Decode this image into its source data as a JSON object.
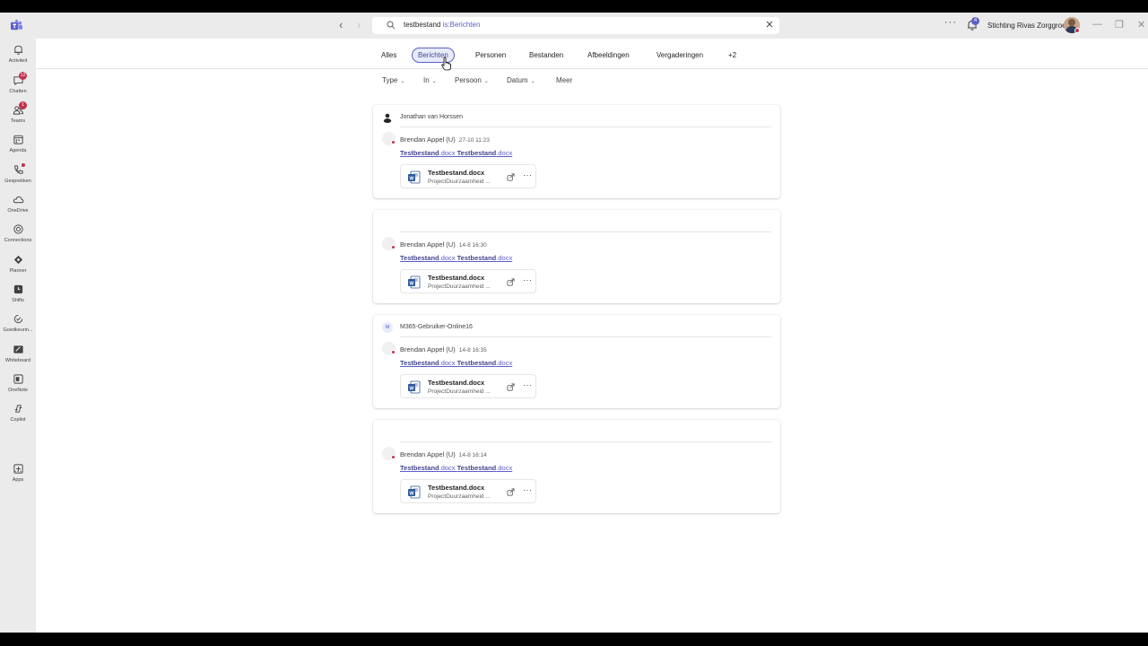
{
  "titlebar": {
    "search_query": "testbestand",
    "search_scope": "is:Berichten",
    "notification_count": "4",
    "org_name": "Stichting Rivas Zorggroep"
  },
  "rail": {
    "items": [
      {
        "label": "Activiteit",
        "icon": "bell-icon"
      },
      {
        "label": "Chatten",
        "icon": "chat-icon",
        "badge": "12"
      },
      {
        "label": "Teams",
        "icon": "teams-icon",
        "badge": "1"
      },
      {
        "label": "Agenda",
        "icon": "calendar-icon"
      },
      {
        "label": "Gesprekken",
        "icon": "phone-icon"
      },
      {
        "label": "OneDrive",
        "icon": "cloud-icon"
      },
      {
        "label": "Connections",
        "icon": "connections-icon"
      },
      {
        "label": "Planner",
        "icon": "planner-icon"
      },
      {
        "label": "Shifts",
        "icon": "shifts-icon"
      },
      {
        "label": "Goedkeurin...",
        "icon": "approvals-icon"
      },
      {
        "label": "Whiteboard",
        "icon": "whiteboard-icon"
      },
      {
        "label": "OneNote",
        "icon": "onenote-icon"
      },
      {
        "label": "Copilot",
        "icon": "copilot-icon"
      },
      {
        "label": "Apps",
        "icon": "apps-icon"
      }
    ],
    "more": "..."
  },
  "tabs": [
    "Alles",
    "Berichten",
    "Personen",
    "Bestanden",
    "Afbeeldingen",
    "Vergaderingen",
    "+2"
  ],
  "selected_tab": "Berichten",
  "filters": [
    "Type",
    "In",
    "Persoon",
    "Datum",
    "Meer"
  ],
  "results": [
    {
      "header": "Jonathan van Horssen",
      "header_avatar": "person",
      "sender": "Brendan Appel (U)",
      "time": "27-10 11:23",
      "body_bold_1": "Testbestand",
      "body_ext_1": ".docx ",
      "body_bold_2": "Testbestand",
      "body_ext_2": ".docx",
      "file_name": "Testbestand.docx",
      "file_path": "ProjectDuurzaamheid ..."
    },
    {
      "header": "",
      "sender": "Brendan Appel (U)",
      "time": "14-8 16:30",
      "body_bold_1": "Testbestand",
      "body_ext_1": ".docx ",
      "body_bold_2": "Testbestand",
      "body_ext_2": ".docx",
      "file_name": "Testbestand.docx",
      "file_path": "ProjectDuurzaamheid ..."
    },
    {
      "header": "M365-Gebruiker-Online16",
      "header_initial": "M",
      "sender": "Brendan Appel (U)",
      "time": "14-8 16:35",
      "body_bold_1": "Testbestand",
      "body_ext_1": ".docx ",
      "body_bold_2": "Testbestand",
      "body_ext_2": ".docx",
      "file_name": "Testbestand.docx",
      "file_path": "ProjectDuurzaamheid ..."
    },
    {
      "header": "",
      "sender": "Brendan Appel (U)",
      "time": "14-8 16:14",
      "body_bold_1": "Testbestand",
      "body_ext_1": ".docx ",
      "body_bold_2": "Testbestand",
      "body_ext_2": ".docx",
      "file_name": "Testbestand.docx",
      "file_path": "ProjectDuurzaamheid ..."
    }
  ],
  "colors": {
    "accent": "#5b5fc7",
    "presence_busy": "#c4314b",
    "rail_bg": "#ebebeb"
  }
}
